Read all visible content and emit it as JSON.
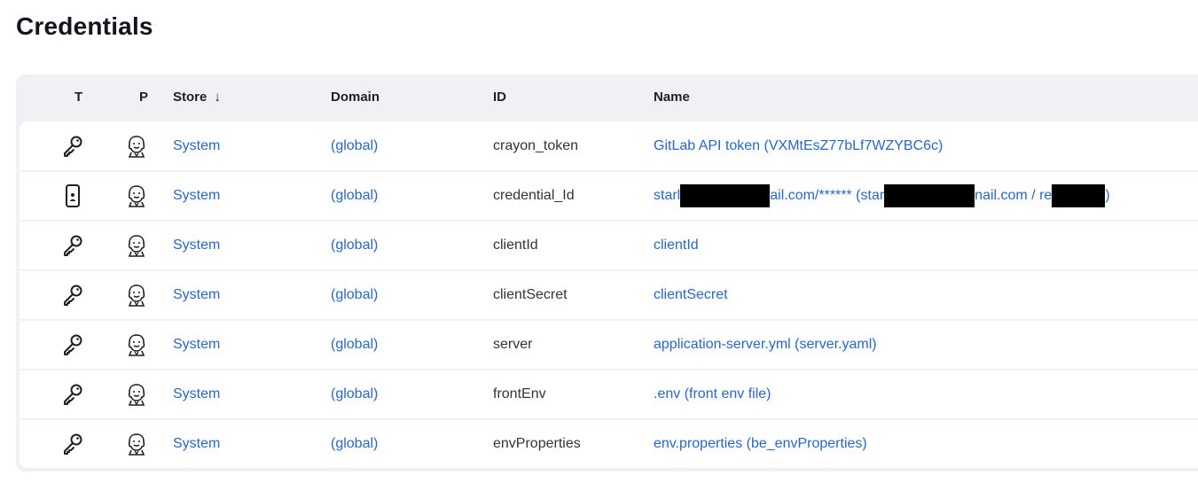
{
  "page": {
    "title": "Credentials"
  },
  "table": {
    "headers": {
      "t": "T",
      "p": "P",
      "store": "Store",
      "sort_indicator": "↓",
      "domain": "Domain",
      "id": "ID",
      "name": "Name"
    },
    "rows": [
      {
        "type_icon": "key-icon",
        "provider_icon": "jenkins-icon",
        "store": "System",
        "domain": "(global)",
        "id": "crayon_token",
        "name": "GitLab API token (VXMtEsZ77bLf7WZYBC6c)"
      },
      {
        "type_icon": "mobile-certificate-icon",
        "provider_icon": "jenkins-icon",
        "store": "System",
        "domain": "(global)",
        "id": "credential_Id",
        "name_parts": [
          "starl",
          "ail.com/****** (star",
          "nail.com / re",
          ")"
        ]
      },
      {
        "type_icon": "key-icon",
        "provider_icon": "jenkins-icon",
        "store": "System",
        "domain": "(global)",
        "id": "clientId",
        "name": "clientId"
      },
      {
        "type_icon": "key-icon",
        "provider_icon": "jenkins-icon",
        "store": "System",
        "domain": "(global)",
        "id": "clientSecret",
        "name": "clientSecret"
      },
      {
        "type_icon": "key-icon",
        "provider_icon": "jenkins-icon",
        "store": "System",
        "domain": "(global)",
        "id": "server",
        "name": "application-server.yml (server.yaml)"
      },
      {
        "type_icon": "key-icon",
        "provider_icon": "jenkins-icon",
        "store": "System",
        "domain": "(global)",
        "id": "frontEnv",
        "name": ".env (front env file)"
      },
      {
        "type_icon": "key-icon",
        "provider_icon": "jenkins-icon",
        "store": "System",
        "domain": "(global)",
        "id": "envProperties",
        "name": "env.properties (be_envProperties)"
      }
    ]
  }
}
